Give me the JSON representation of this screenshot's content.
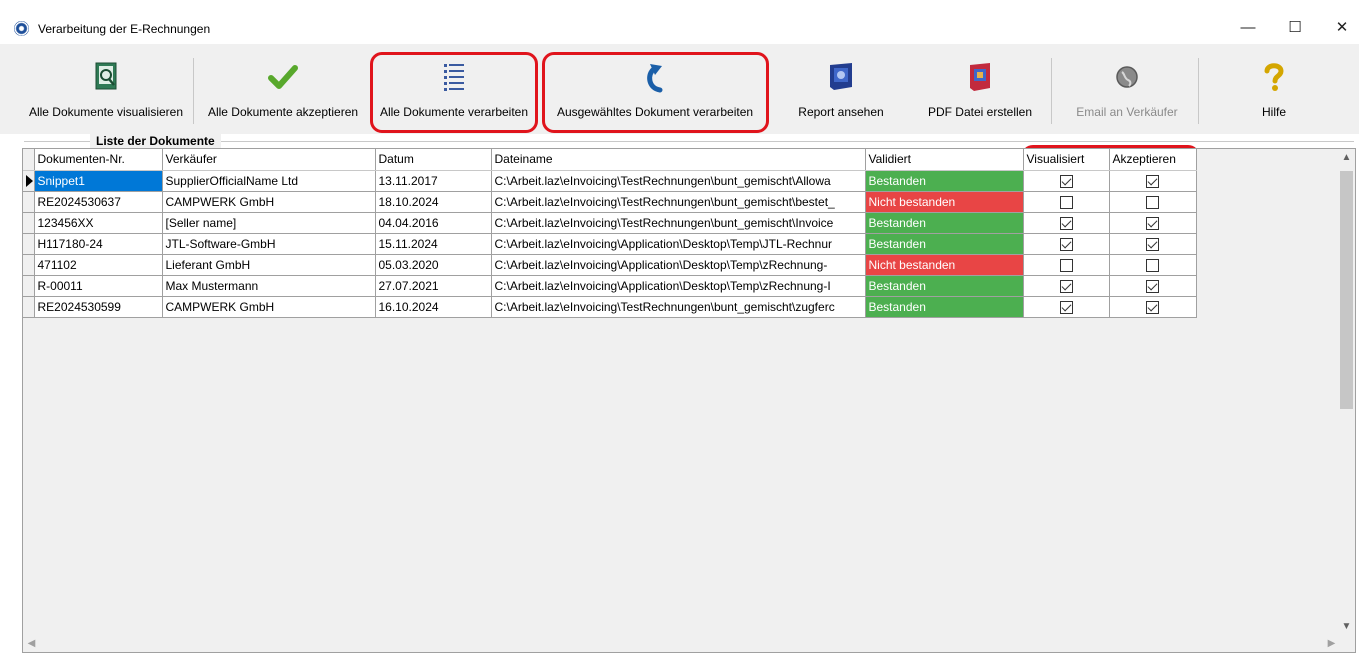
{
  "window": {
    "title": "Verarbeitung der E-Rechnungen",
    "minimize_glyph": "—",
    "maximize_glyph": "☐",
    "close_glyph": "✕"
  },
  "toolbar": {
    "visualize_all": "Alle Dokumente visualisieren",
    "accept_all": "Alle Dokumente akzeptieren",
    "process_all": "Alle Dokumente verarbeiten",
    "process_selected": "Ausgewähltes Dokument verarbeiten",
    "view_report": "Report ansehen",
    "create_pdf": "PDF Datei erstellen",
    "email_seller": "Email an Verkäufer",
    "help": "Hilfe"
  },
  "document_list": {
    "title": "Liste der Dokumente",
    "columns": [
      "Dokumenten-Nr.",
      "Verkäufer",
      "Datum",
      "Dateiname",
      "Validiert",
      "Visualisiert",
      "Akzeptieren"
    ],
    "rows": [
      {
        "nr": "Snippet1",
        "seller": "SupplierOfficialName Ltd",
        "date": "13.11.2017",
        "file": "C:\\Arbeit.laz\\eInvoicing\\TestRechnungen\\bunt_gemischt\\Allowa",
        "validated": "Bestanden",
        "status": "ok",
        "visualized": true,
        "accept": true
      },
      {
        "nr": "RE2024530637",
        "seller": "CAMPWERK GmbH",
        "date": "18.10.2024",
        "file": "C:\\Arbeit.laz\\eInvoicing\\TestRechnungen\\bunt_gemischt\\bestet_",
        "validated": "Nicht bestanden",
        "status": "fail",
        "visualized": false,
        "accept": false
      },
      {
        "nr": "123456XX",
        "seller": "[Seller name]",
        "date": "04.04.2016",
        "file": "C:\\Arbeit.laz\\eInvoicing\\TestRechnungen\\bunt_gemischt\\Invoice",
        "validated": "Bestanden",
        "status": "ok",
        "visualized": true,
        "accept": true
      },
      {
        "nr": "H117180-24",
        "seller": "JTL-Software-GmbH",
        "date": "15.11.2024",
        "file": "C:\\Arbeit.laz\\eInvoicing\\Application\\Desktop\\Temp\\JTL-Rechnur",
        "validated": "Bestanden",
        "status": "ok",
        "visualized": true,
        "accept": true
      },
      {
        "nr": "471102",
        "seller": "Lieferant GmbH",
        "date": "05.03.2020",
        "file": "C:\\Arbeit.laz\\eInvoicing\\Application\\Desktop\\Temp\\zRechnung-",
        "validated": "Nicht bestanden",
        "status": "fail",
        "visualized": false,
        "accept": false
      },
      {
        "nr": "R-00011",
        "seller": "Max Mustermann",
        "date": "27.07.2021",
        "file": "C:\\Arbeit.laz\\eInvoicing\\Application\\Desktop\\Temp\\zRechnung-I",
        "validated": "Bestanden",
        "status": "ok",
        "visualized": true,
        "accept": true
      },
      {
        "nr": "RE2024530599",
        "seller": "CAMPWERK GmbH",
        "date": "16.10.2024",
        "file": "C:\\Arbeit.laz\\eInvoicing\\TestRechnungen\\bunt_gemischt\\zugferc",
        "validated": "Bestanden",
        "status": "ok",
        "visualized": true,
        "accept": true
      }
    ],
    "selected_row": 0
  },
  "colors": {
    "pass": "#4caf50",
    "fail": "#e84545",
    "selection": "#0078d7",
    "highlight": "#e0141c"
  },
  "icons": {
    "app": "gear-badge-icon",
    "visualize_all": "document-view-icon",
    "accept_all": "green-checkmark-icon",
    "process_all": "list-icon",
    "process_selected": "curved-arrow-icon",
    "view_report": "report-icon",
    "create_pdf": "pdf-icon",
    "email_seller": "globe-icon",
    "help": "question-mark-icon"
  }
}
